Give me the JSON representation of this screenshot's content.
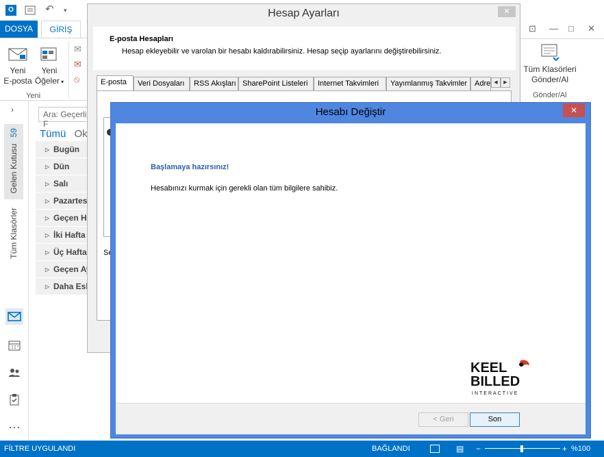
{
  "outlook": {
    "tabs": {
      "file": "DOSYA",
      "home": "GİRİŞ"
    },
    "ribbon": {
      "new_email_line1": "Yeni",
      "new_email_line2": "E-posta",
      "new_items_line1": "Yeni",
      "new_items_line2": "Öğeler",
      "group_new": "Yeni",
      "all_folders_line1": "Tüm Klasörleri",
      "all_folders_line2": "Gönder/Al",
      "group_sendreceive": "Gönder/Al"
    },
    "rail": {
      "inbox": "Gelen Kutusu",
      "inbox_count": "59",
      "all_folders": "Tüm Klasörler"
    },
    "search_placeholder": "Ara: Geçerli F",
    "filter_all": "Tümü",
    "filter_unread": "Ok",
    "groups": [
      "Bugün",
      "Dün",
      "Salı",
      "Pazartesi",
      "Geçen Ha",
      "İki Hafta Ö",
      "Üç Hafta Ö",
      "Geçen Ay",
      "Daha Eski"
    ],
    "status": {
      "filter": "FİLTRE UYGULANDI",
      "connected": "BAĞLANDI",
      "zoom": "%100"
    }
  },
  "account_settings": {
    "title": "Hesap Ayarları",
    "close": "✕",
    "header_title": "E-posta Hesapları",
    "header_desc": "Hesap ekleyebilir ve varolan bir hesabı kaldırabilirsiniz. Hesap seçip ayarlarını değiştirebilirsiniz.",
    "tabs": [
      "E-posta",
      "Veri Dosyaları",
      "RSS Akışları",
      "SharePoint Listeleri",
      "Internet Takvimleri",
      "Yayımlanmış Takvimler",
      "Adre"
    ],
    "list_label": "Se"
  },
  "change_account": {
    "title": "Hesabı Değiştir",
    "close": "✕",
    "heading": "Başlamaya hazırsınız!",
    "message": "Hesabınızı kurmak için gerekli olan tüm bilgilere sahibiz.",
    "logo_line1": "KEEL",
    "logo_line2": "BILLED",
    "logo_tagline": "INTERACTIVE",
    "back_button": "< Geri",
    "finish_button": "Son"
  },
  "colors": {
    "accent": "#0072c6",
    "dialog_frame": "#4f86e0",
    "close_red": "#c75050"
  }
}
